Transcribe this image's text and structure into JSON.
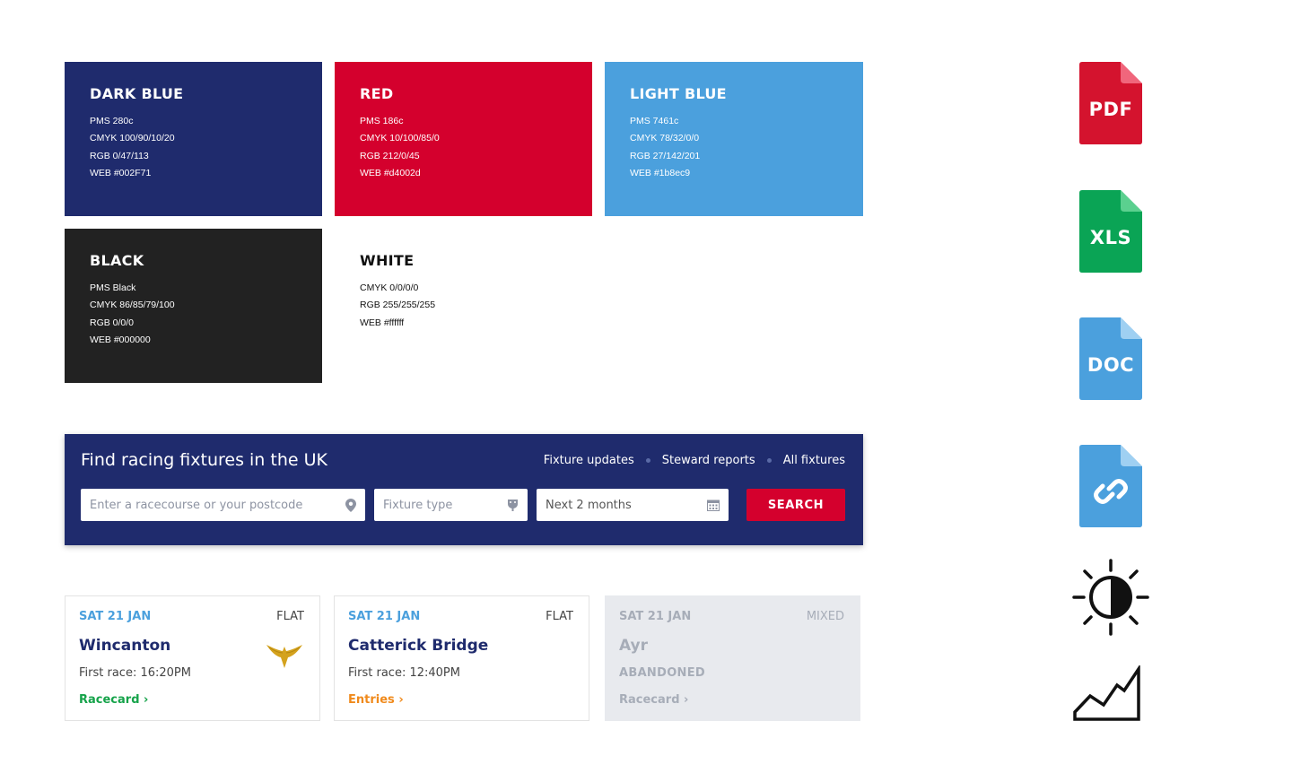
{
  "swatches": {
    "dark_blue": {
      "title": "DARK BLUE",
      "lines": [
        "PMS 280c",
        "CMYK 100/90/10/20",
        "RGB 0/47/113",
        "WEB #002F71"
      ],
      "color": "#1f2b6d"
    },
    "red": {
      "title": "RED",
      "lines": [
        "PMS 186c",
        "CMYK 10/100/85/0",
        "RGB 212/0/45",
        "WEB #d4002d"
      ],
      "color": "#d4002d"
    },
    "light_blue": {
      "title": "LIGHT BLUE",
      "lines": [
        "PMS 7461c",
        "CMYK 78/32/0/0",
        "RGB 27/142/201",
        "WEB #1b8ec9"
      ],
      "color": "#4ba0dd"
    },
    "black": {
      "title": "BLACK",
      "lines": [
        "PMS Black",
        "CMYK 86/85/79/100",
        "RGB 0/0/0",
        "WEB #000000"
      ],
      "color": "#222222"
    },
    "white": {
      "title": "WHITE",
      "lines": [
        "CMYK 0/0/0/0",
        "RGB 255/255/255",
        "WEB #ffffff"
      ],
      "color": "#ffffff"
    }
  },
  "finder": {
    "title": "Find racing fixtures in the UK",
    "links": [
      "Fixture updates",
      "Steward reports",
      "All fixtures"
    ],
    "location_placeholder": "Enter a racecourse or your postcode",
    "fixture_type_placeholder": "Fixture type",
    "date_value": "Next 2 months",
    "search_label": "SEARCH",
    "icons": {
      "location": "location-pin-icon",
      "fixture_type": "horse-shoe-icon",
      "date": "calendar-icon"
    }
  },
  "fixtures": [
    {
      "date": "SAT 21 JAN",
      "type": "FLAT",
      "course": "Wincanton",
      "info": "First race: 16:20PM",
      "link": "Racecard",
      "link_color": "#16a34a",
      "badge": "gold-wings-icon"
    },
    {
      "date": "SAT 21 JAN",
      "type": "FLAT",
      "course": "Catterick Bridge",
      "info": "First race: 12:40PM",
      "link": "Entries",
      "link_color": "#f08a1c"
    },
    {
      "date": "SAT 21 JAN",
      "type": "MIXED",
      "course": "Ayr",
      "info": "ABANDONED",
      "link": "Racecard",
      "link_color": "#a7adb8"
    }
  ],
  "file_icons": [
    {
      "label": "PDF",
      "color": "#d4132e",
      "fold": "#f0667c"
    },
    {
      "label": "XLS",
      "color": "#0aa455",
      "fold": "#5bd08f"
    },
    {
      "label": "DOC",
      "color": "#4ba0dd",
      "fold": "#9fd0f2"
    },
    {
      "label": "",
      "color": "#4ba0dd",
      "fold": "#9fd0f2",
      "glyph": "link-icon"
    }
  ],
  "other_icons": [
    "brightness-contrast-icon",
    "area-chart-icon"
  ]
}
